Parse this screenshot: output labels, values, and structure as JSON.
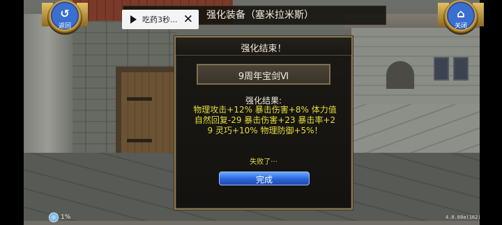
{
  "window": {
    "title": "强化装备（塞米拉米斯）"
  },
  "notification": {
    "text": "吃药3秒..."
  },
  "buttons": {
    "back_label": "返回",
    "close_label": "关闭"
  },
  "dialog": {
    "title": "强化结束！",
    "item_name": "9周年宝剑Ⅵ",
    "result_label": "强化结果:",
    "result_lines": [
      "物理攻击+12% 暴击伤害+8% 体力值",
      "自然回复-29 暴击伤害+23 暴击率+2",
      "9 灵巧+10% 物理防御+5%！"
    ],
    "status": "失败了···",
    "confirm_label": "完成"
  },
  "hud": {
    "exp_percent": "1%",
    "version": "4.0.60a(162)"
  }
}
